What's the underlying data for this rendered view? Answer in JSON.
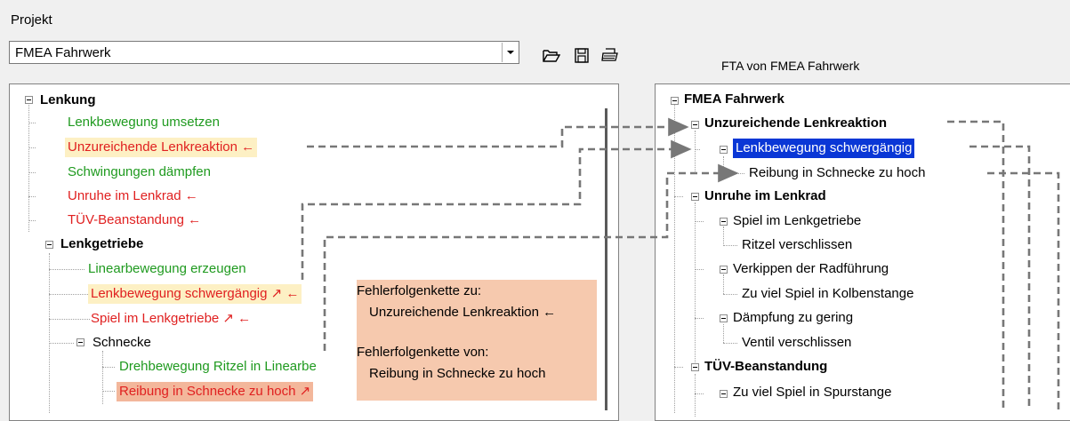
{
  "header": {
    "projekt_label": "Projekt",
    "combo_value": "FMEA Fahrwerk",
    "fta_title": "FTA von FMEA Fahrwerk"
  },
  "toolbar": {
    "icons": [
      "open-folder-icon",
      "save-icon",
      "print-icon"
    ]
  },
  "left_tree": {
    "root": "Lenkung",
    "items": [
      {
        "label": "Lenkbewegung umsetzen"
      },
      {
        "label": "Unzureichende Lenkreaktion ←"
      },
      {
        "label": "Schwingungen dämpfen"
      },
      {
        "label": "Unruhe im Lenkrad ←"
      },
      {
        "label": "TÜV-Beanstandung ←"
      },
      {
        "label": "Lenkgetriebe"
      },
      {
        "label": "Linearbewegung erzeugen"
      },
      {
        "label": "Lenkbewegung schwergängig ↗ ←"
      },
      {
        "label": "Spiel im Lenkgetriebe ↗ ←"
      },
      {
        "label": "Schnecke"
      },
      {
        "label": "Drehbewegung Ritzel in Linearbe"
      },
      {
        "label": "Reibung in Schnecke zu hoch ↗"
      }
    ]
  },
  "info_box": {
    "line1": "Fehlerfolgenkette zu:",
    "line2": "Unzureichende Lenkreaktion ←",
    "line3": "Fehlerfolgenkette von:",
    "line4": "Reibung in Schnecke zu hoch"
  },
  "right_tree": {
    "root": "FMEA Fahrwerk",
    "items": [
      {
        "label": "Unzureichende Lenkreaktion"
      },
      {
        "label": "Lenkbewegung schwergängig"
      },
      {
        "label": "Reibung in Schnecke zu hoch"
      },
      {
        "label": "Unruhe im Lenkrad"
      },
      {
        "label": "Spiel im Lenkgetriebe"
      },
      {
        "label": "Ritzel verschlissen"
      },
      {
        "label": "Verkippen der Radführung"
      },
      {
        "label": "Zu viel Spiel in Kolbenstange"
      },
      {
        "label": "Dämpfung zu gering"
      },
      {
        "label": "Ventil verschlissen"
      },
      {
        "label": "TÜV-Beanstandung"
      },
      {
        "label": "Zu viel Spiel in Spurstange"
      }
    ]
  },
  "colors": {
    "green": "#1f9a1f",
    "red": "#e02020",
    "selection": "#0a37d6",
    "highlight_yellow": "#fdf0c4",
    "highlight_orange": "#f3b79b"
  }
}
